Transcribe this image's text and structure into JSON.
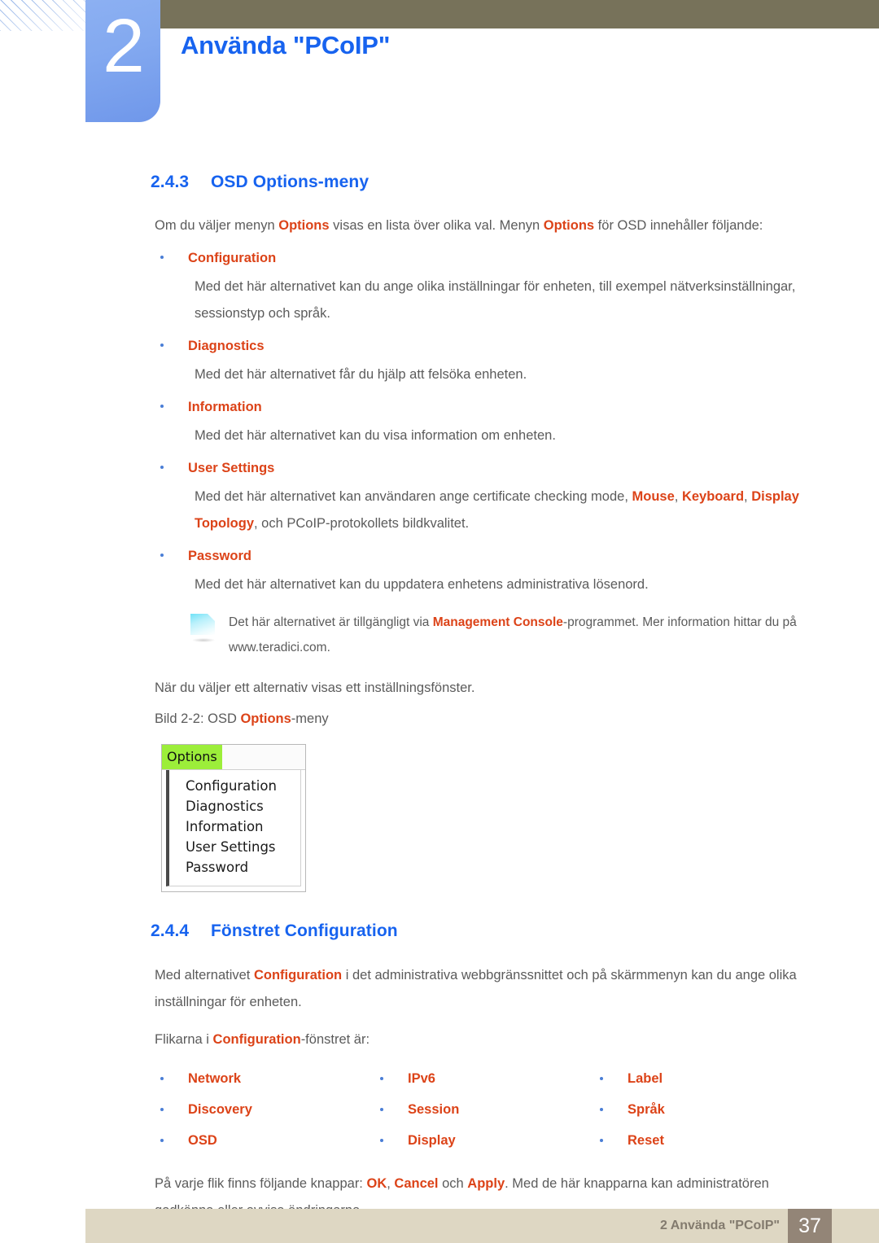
{
  "header": {
    "chapter_number": "2",
    "chapter_title": "Använda \"PCoIP\"",
    "tab_color": "#83a9f0",
    "bar_color": "#77725a",
    "title_color": "#1763ef"
  },
  "sections": {
    "s243": {
      "number": "2.4.3",
      "title": "OSD Options-meny",
      "intro_a": "Om du väljer menyn ",
      "intro_hl1": "Options",
      "intro_b": " visas en lista över olika val. Menyn ",
      "intro_hl2": "Options",
      "intro_c": " för OSD innehåller följande:",
      "items": [
        {
          "label": "Configuration",
          "desc": "Med det här alternativet kan du ange olika inställningar för enheten, till exempel nätverksinställningar, sessionstyp och språk."
        },
        {
          "label": "Diagnostics",
          "desc": "Med det här alternativet får du hjälp att felsöka enheten."
        },
        {
          "label": "Information",
          "desc": "Med det här alternativet kan du visa information om enheten."
        },
        {
          "label": "User Settings",
          "desc_a": "Med det här alternativet kan användaren ange certificate checking mode, ",
          "desc_hl1": "Mouse",
          "desc_b": ", ",
          "desc_hl2": "Keyboard",
          "desc_c": ", ",
          "desc_hl3": "Display Topology",
          "desc_d": ", och PCoIP-protokollets bildkvalitet."
        },
        {
          "label": "Password",
          "desc": "Med det här alternativet kan du uppdatera enhetens administrativa lösenord."
        }
      ],
      "note": {
        "icon": "note-icon",
        "text_a": "Det här alternativet är tillgängligt via ",
        "text_hl": "Management Console",
        "text_b": "-programmet. Mer information hittar du på www.teradici.com."
      },
      "after_note": "När du väljer ett alternativ visas ett inställningsfönster.",
      "figure_caption_a": "Bild 2-2: OSD ",
      "figure_caption_hl": "Options",
      "figure_caption_b": "-meny"
    },
    "figure": {
      "tab_label": "Options",
      "tab_highlight_color": "#9cee3a",
      "menu_items": [
        "Configuration",
        "Diagnostics",
        "Information",
        "User Settings",
        "Password"
      ]
    },
    "s244": {
      "number": "2.4.4",
      "title": "Fönstret Configuration",
      "para1_a": "Med alternativet ",
      "para1_hl": "Configuration",
      "para1_b": " i det administrativa webbgränssnittet och på skärmmenyn kan du ange olika inställningar för enheten.",
      "para2_a": "Flikarna i ",
      "para2_hl": "Configuration",
      "para2_b": "-fönstret är:",
      "tab_columns": [
        [
          "Network",
          "Discovery",
          "OSD"
        ],
        [
          "IPv6",
          "Session",
          "Display"
        ],
        [
          "Label",
          "Språk",
          "Reset"
        ]
      ],
      "para3_a": "På varje flik finns följande knappar: ",
      "para3_hl1": "OK",
      "para3_b": ", ",
      "para3_hl2": "Cancel",
      "para3_c": " och ",
      "para3_hl3": "Apply",
      "para3_d": ". Med de här knapparna kan administratören godkänna eller avvisa ändringarna."
    }
  },
  "footer": {
    "text": "2 Använda \"PCoIP\"",
    "page_number": "37",
    "bar_color": "#ded7c3",
    "page_box_color": "#938577"
  }
}
